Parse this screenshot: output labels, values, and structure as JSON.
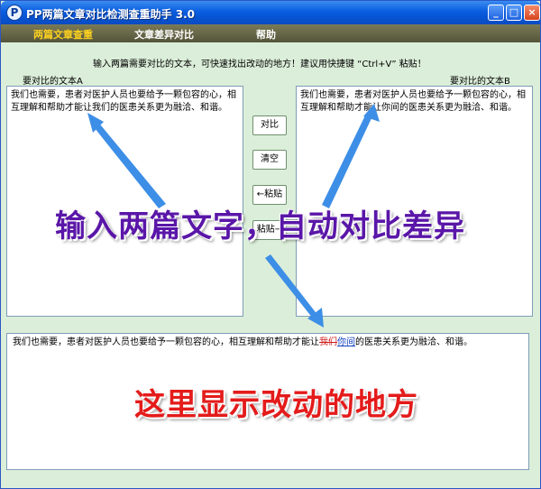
{
  "window": {
    "title": "PP两篇文章对比检测查重助手 3.0",
    "icon_letter": "P",
    "controls": {
      "minimize": "_",
      "maximize": "□",
      "close": "×"
    }
  },
  "menu": {
    "items": [
      {
        "label": "两篇文章查重",
        "active": true
      },
      {
        "label": "文章差异对比",
        "active": false
      },
      {
        "label": "帮助",
        "active": false
      }
    ]
  },
  "instruction": "输入两篇需要对比的文本，可快速找出改动的地方！建议用快捷键 “Ctrl+V” 粘贴！",
  "panel_a": {
    "label": "要对比的文本A",
    "text": "我们也需要，患者对医护人员也要给予一颗包容的心，相互理解和帮助才能让我们的医患关系更为融洽、和谐。"
  },
  "panel_b": {
    "label": "要对比的文本B",
    "text": "我们也需要，患者对医护人员也要给予一颗包容的心，相互理解和帮助才能让你间的医患关系更为融洽、和谐。"
  },
  "buttons": {
    "compare": "对比",
    "clear": "清空",
    "paste_left": "←粘贴",
    "paste_right": "粘贴→"
  },
  "result": {
    "prefix": "我们也需要，患者对医护人员也要给予一颗包容的心，相互理解和帮助才能让",
    "deleted": "我们",
    "inserted": "你间",
    "suffix": "的医患关系更为融洽、和谐。"
  },
  "annotations": {
    "top": "输入两篇文字，自动对比差异",
    "bottom": "这里显示改动的地方"
  },
  "colors": {
    "window_bg": "#dbeed9",
    "titlebar": "#0a5ee0",
    "menubar": "#54543a",
    "menu_active": "#ffd21e",
    "annotation_top": "#5a16a8",
    "annotation_bottom": "#e41b1b",
    "arrow": "#3d8ee6"
  }
}
